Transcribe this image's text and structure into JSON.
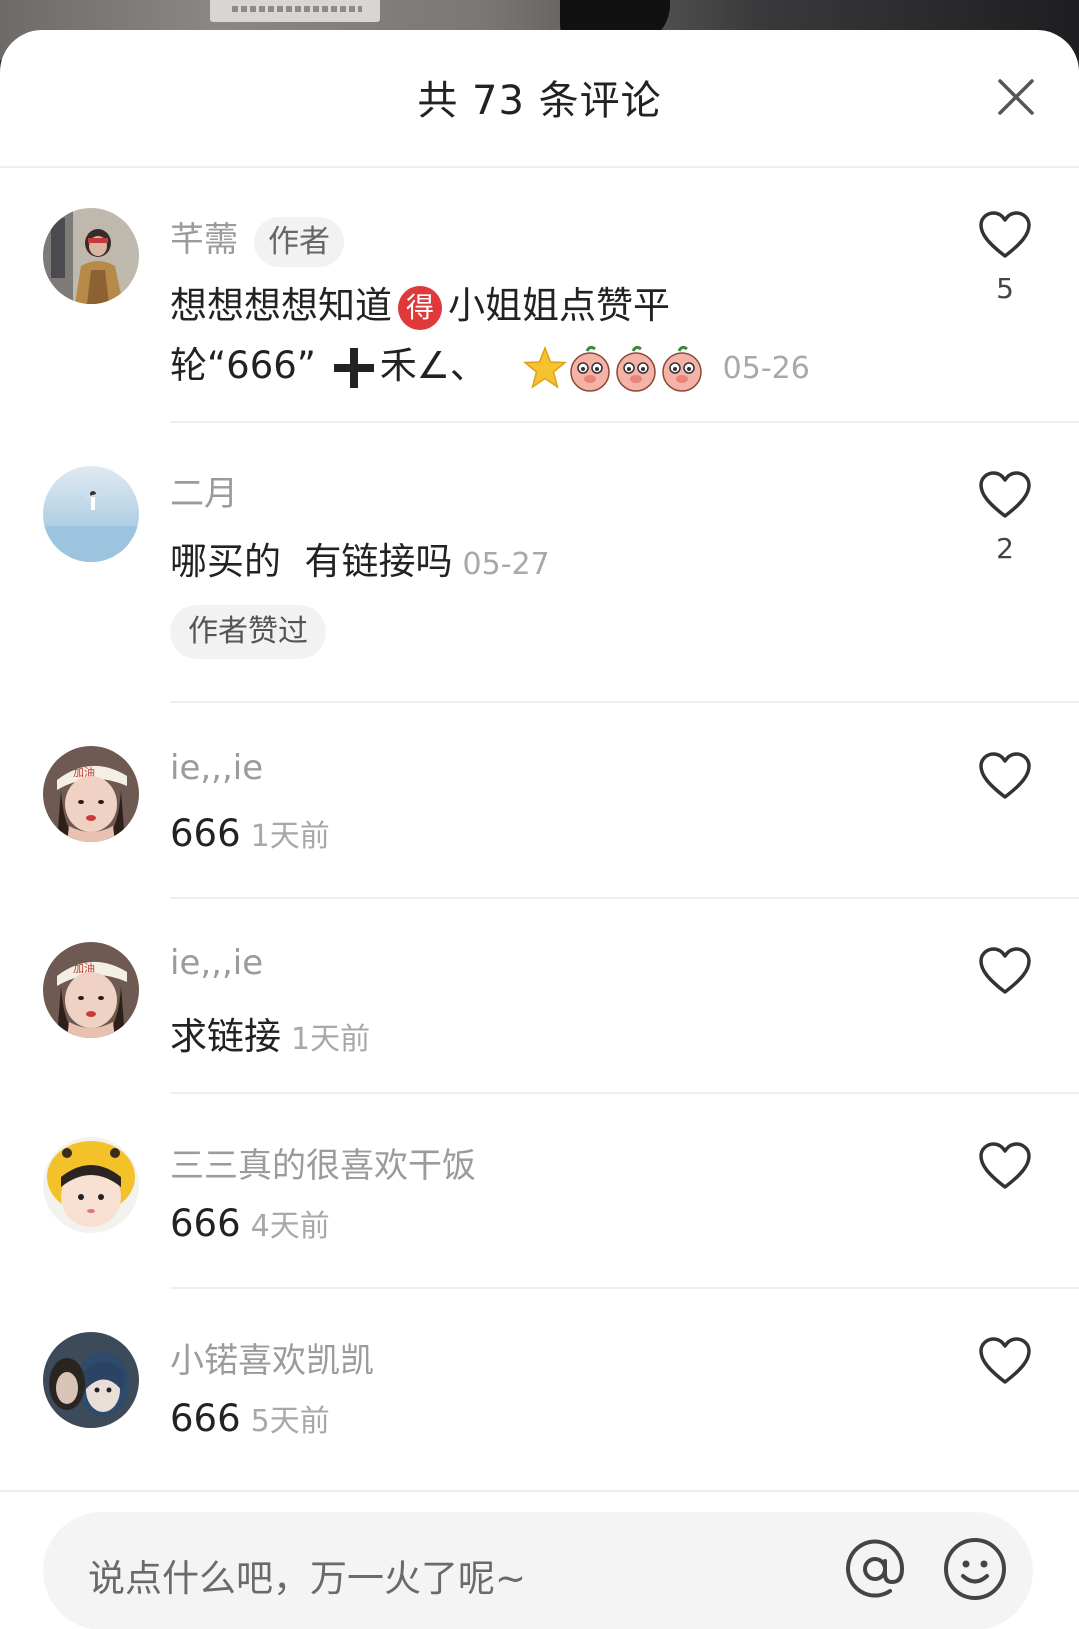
{
  "header": {
    "title": "共 73 条评论"
  },
  "comments": [
    {
      "name": "芊薷",
      "author_tag": "作者",
      "text_line1": "想想想想知道",
      "badge": "得",
      "text_line1b": "小姐姐点赞平",
      "text_line2": "轮“666”",
      "text_line2b": "禾∠、",
      "time": "05-26",
      "likes": "5"
    },
    {
      "name": "二月",
      "text": "哪买的  有链接吗",
      "time": "05-27",
      "liked_tag": "作者赞过",
      "likes": "2"
    },
    {
      "name": "ie,,,ie",
      "text": "666",
      "time": "1天前"
    },
    {
      "name": "ie,,,ie",
      "text": "求链接",
      "time": "1天前"
    },
    {
      "name": "三三真的很喜欢干饭",
      "text": "666",
      "time": "4天前"
    },
    {
      "name": "小锘喜欢凯凯",
      "text": "666",
      "time": "5天前"
    }
  ],
  "footer": {
    "placeholder": "说点什么吧，万一火了呢~"
  },
  "icons": {
    "close": "close-icon",
    "like": "heart-outline-icon",
    "at": "at-icon",
    "emoji": "smiley-icon"
  },
  "colors": {
    "accent_badge": "#e0393b",
    "text_primary": "#222222",
    "text_secondary": "#9b9b9b"
  }
}
